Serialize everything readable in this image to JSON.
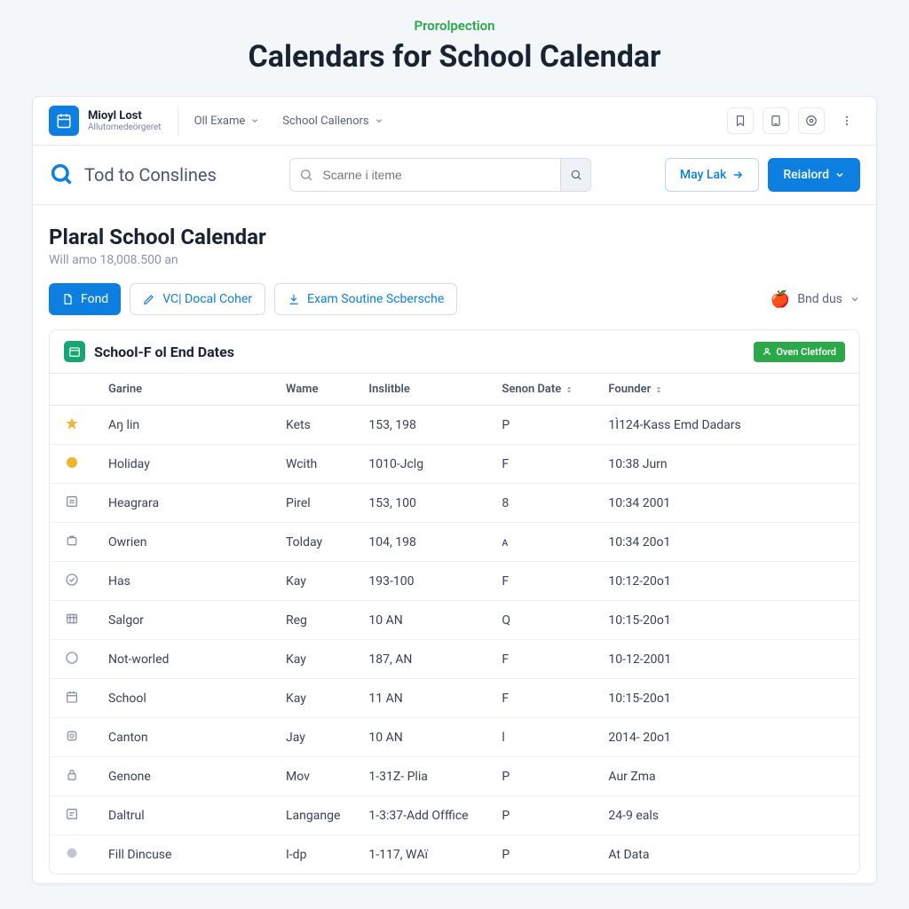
{
  "top_caption": "Prorolpection",
  "page_title": "Calendars for School Calendar",
  "header": {
    "brand": "Mioyl Lost",
    "brand_sub": "Allutomedeörgeret",
    "nav_1": "Oll Exame",
    "nav_2": "School Callenors"
  },
  "search": {
    "label": "Tod to Conslines",
    "placeholder": "Scarne i iteme"
  },
  "buttons": {
    "may_lak": "May Lak",
    "reialord": "Reialord",
    "fond": "Fond",
    "vc_docal": "VC| Docal Coher",
    "exam_sout": "Exam Soutine Scbersche",
    "end_us": "Bnd dus",
    "oven": "Oven Cletford"
  },
  "content": {
    "title": "Plaral School Calendar",
    "subtitle": "Will amo 18,008.500 an",
    "table_title": "School-F ol End Dates"
  },
  "columns": {
    "c1": "Garine",
    "c2": "Wame",
    "c3": "Inslitble",
    "c4": "Senon Date",
    "c5": "Founder"
  },
  "rows": [
    {
      "name": "Aŋ lin",
      "wame": "Kets",
      "inst": "153, 198",
      "seson": "P",
      "founder": "1Ì124-Kass Emd Dadars"
    },
    {
      "name": "Holiday",
      "wame": "Wcith",
      "inst": "1010-Jclg",
      "seson": "F",
      "founder": "10:38 Jurn"
    },
    {
      "name": "Heagrara",
      "wame": "Pirel",
      "inst": "153, 100",
      "seson": "8",
      "founder": "10:34 2001"
    },
    {
      "name": "Owrien",
      "wame": "Tolday",
      "inst": "104, 198",
      "seson": "ᴀ",
      "founder": "10:34 20o1"
    },
    {
      "name": "Has",
      "wame": "Kay",
      "inst": "193-100",
      "seson": "F",
      "founder": "10:12-20o1"
    },
    {
      "name": "Salgor",
      "wame": "Reg",
      "inst": "10 AN",
      "seson": "Q",
      "founder": "10:15-20o1"
    },
    {
      "name": "Not-worled",
      "wame": "Kay",
      "inst": "187, AN",
      "seson": "F",
      "founder": "10-12-2001"
    },
    {
      "name": "School",
      "wame": "Kay",
      "inst": "11 AN",
      "seson": "F",
      "founder": "10:15-20o1"
    },
    {
      "name": "Canton",
      "wame": "Jay",
      "inst": "10 AN",
      "seson": "l",
      "founder": "2014- 20o1"
    },
    {
      "name": "Genone",
      "wame": "Mov",
      "inst": "1-31Z- Plia",
      "seson": "P",
      "founder": "Aur Zma"
    },
    {
      "name": "Daltrul",
      "wame": "Langange",
      "inst": "1-3:37-Add Offfice",
      "seson": "P",
      "founder": "24-9 eals"
    },
    {
      "name": "Fill Dincuse",
      "wame": "I-dp",
      "inst": "1-117, WАï",
      "seson": "P",
      "founder": "At Data"
    }
  ]
}
